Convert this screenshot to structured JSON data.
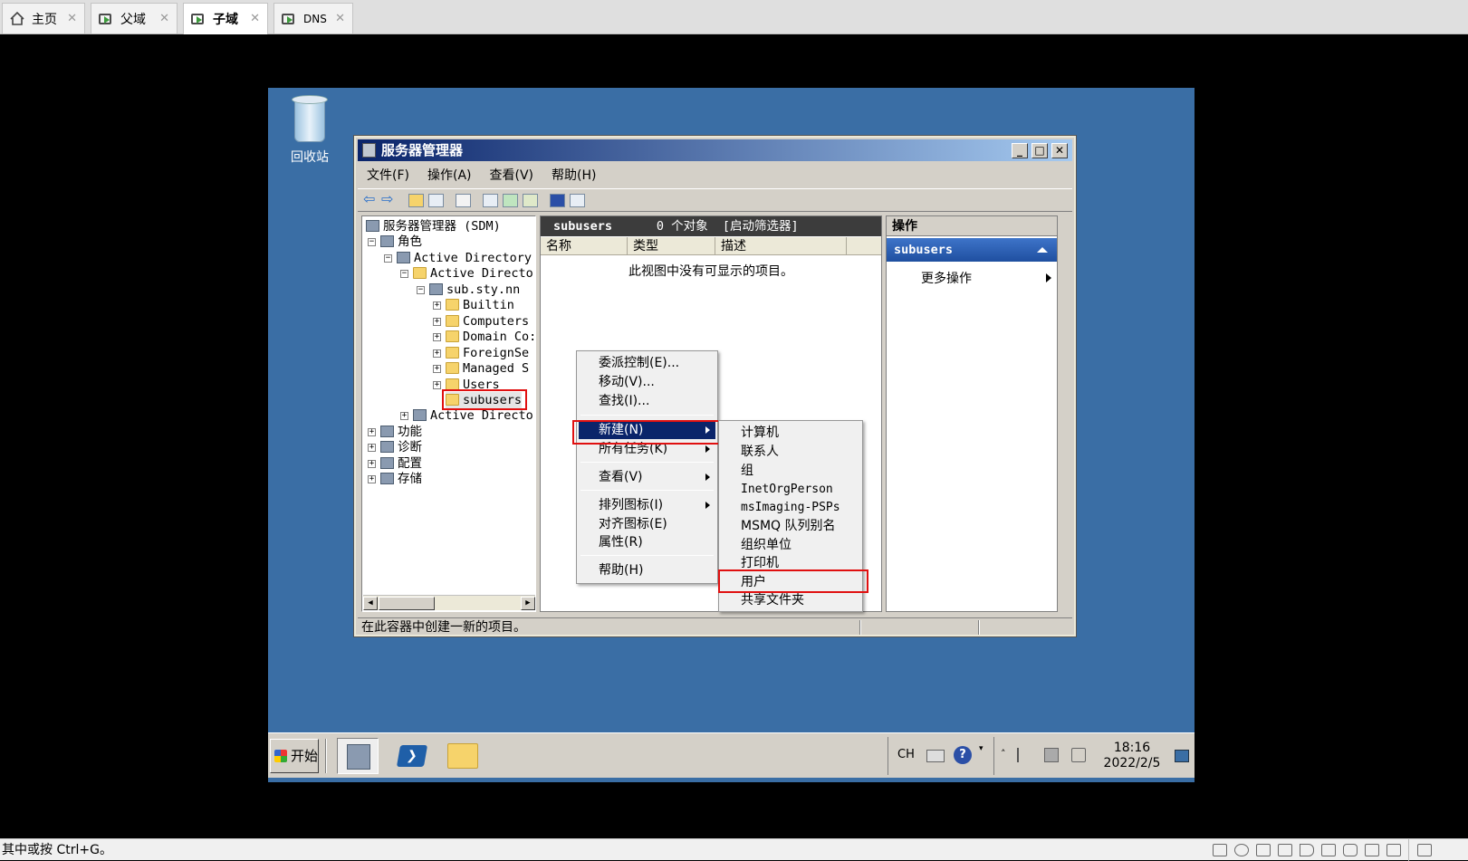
{
  "host_tabs": [
    {
      "label": "主页",
      "icon": "home-icon",
      "active": false
    },
    {
      "label": "父域",
      "icon": "vm-icon",
      "active": false
    },
    {
      "label": "子域",
      "icon": "vm-icon",
      "active": true
    },
    {
      "label": "DNS",
      "icon": "vm-icon",
      "active": false
    }
  ],
  "desktop": {
    "recycle_bin_label": "回收站"
  },
  "window": {
    "title": "服务器管理器",
    "menu": [
      "文件(F)",
      "操作(A)",
      "查看(V)",
      "帮助(H)"
    ],
    "tree": [
      {
        "label": "服务器管理器 (SDM)",
        "expander": ""
      },
      {
        "label": "角色",
        "expander": "⊟"
      },
      {
        "label": "Active Directory",
        "expander": "⊟"
      },
      {
        "label": "Active Directo",
        "expander": "⊟"
      },
      {
        "label": "sub.sty.nn",
        "expander": "⊟"
      },
      {
        "label": "Builtin",
        "expander": "⊞"
      },
      {
        "label": "Computers",
        "expander": "⊞"
      },
      {
        "label": "Domain Co:",
        "expander": "⊞"
      },
      {
        "label": "ForeignSe",
        "expander": "⊞"
      },
      {
        "label": "Managed S",
        "expander": "⊞"
      },
      {
        "label": "Users",
        "expander": "⊞"
      },
      {
        "label": "subusers",
        "expander": ""
      },
      {
        "label": "Active Directo",
        "expander": "⊞"
      },
      {
        "label": "功能",
        "expander": "⊞"
      },
      {
        "label": "诊断",
        "expander": "⊞"
      },
      {
        "label": "配置",
        "expander": "⊞"
      },
      {
        "label": "存储",
        "expander": "⊞"
      }
    ],
    "center": {
      "header_title": "subusers",
      "header_count": "0 个对象",
      "header_filter": "[启动筛选器]",
      "columns": [
        "名称",
        "类型",
        "描述"
      ],
      "empty_message": "此视图中没有可显示的项目。"
    },
    "actions": {
      "header": "操作",
      "selected": "subusers",
      "more": "更多操作"
    },
    "status_text": "在此容器中创建一新的项目。"
  },
  "context_menu": {
    "items": [
      "委派控制(E)...",
      "移动(V)...",
      "查找(I)...",
      "新建(N)",
      "所有任务(K)",
      "查看(V)",
      "排列图标(I)",
      "对齐图标(E)",
      "属性(R)",
      "帮助(H)"
    ],
    "highlighted": "新建(N)"
  },
  "submenu": {
    "items": [
      "计算机",
      "联系人",
      "组",
      "InetOrgPerson",
      "msImaging-PSPs",
      "MSMQ 队列别名",
      "组织单位",
      "打印机",
      "用户",
      "共享文件夹"
    ],
    "boxed": "用户"
  },
  "taskbar": {
    "start_label": "开始",
    "lang": "CH",
    "time": "18:16",
    "date": "2022/2/5"
  },
  "host_status": {
    "text": "其中或按 Ctrl+G。"
  }
}
